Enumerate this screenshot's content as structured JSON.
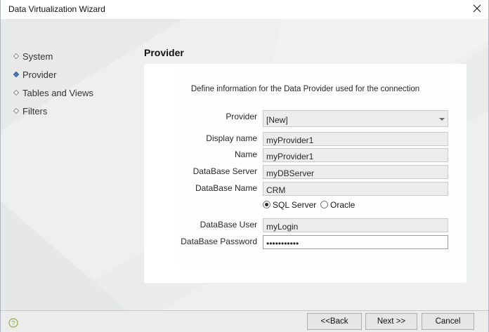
{
  "window": {
    "title": "Data Virtualization Wizard",
    "close_icon": "close-icon"
  },
  "nav": {
    "items": [
      {
        "label": "System",
        "active": false
      },
      {
        "label": "Provider",
        "active": true
      },
      {
        "label": "Tables and Views",
        "active": false
      },
      {
        "label": "Filters",
        "active": false
      }
    ]
  },
  "page": {
    "title": "Provider",
    "intro": "Define information for the Data Provider used for the connection"
  },
  "form": {
    "provider": {
      "label": "Provider",
      "value": "[New]"
    },
    "display_name": {
      "label": "Display name",
      "value": "myProvider1"
    },
    "name": {
      "label": "Name",
      "value": "myProvider1"
    },
    "db_server": {
      "label": "DataBase Server",
      "value": "myDBServer"
    },
    "db_name": {
      "label": "DataBase Name",
      "value": "CRM"
    },
    "db_type": {
      "options": [
        "SQL Server",
        "Oracle"
      ],
      "selected": "SQL Server"
    },
    "db_user": {
      "label": "DataBase User",
      "value": "myLogin"
    },
    "db_password": {
      "label": "DataBase Password",
      "value": "•••••••••••"
    }
  },
  "footer": {
    "back_label": "<<Back",
    "next_label": "Next >>",
    "cancel_label": "Cancel",
    "help_icon": "help-icon"
  },
  "colors": {
    "active_bullet": "#4b78b8",
    "window_bg": "#eef0ef",
    "panel_bg": "#ffffff"
  }
}
